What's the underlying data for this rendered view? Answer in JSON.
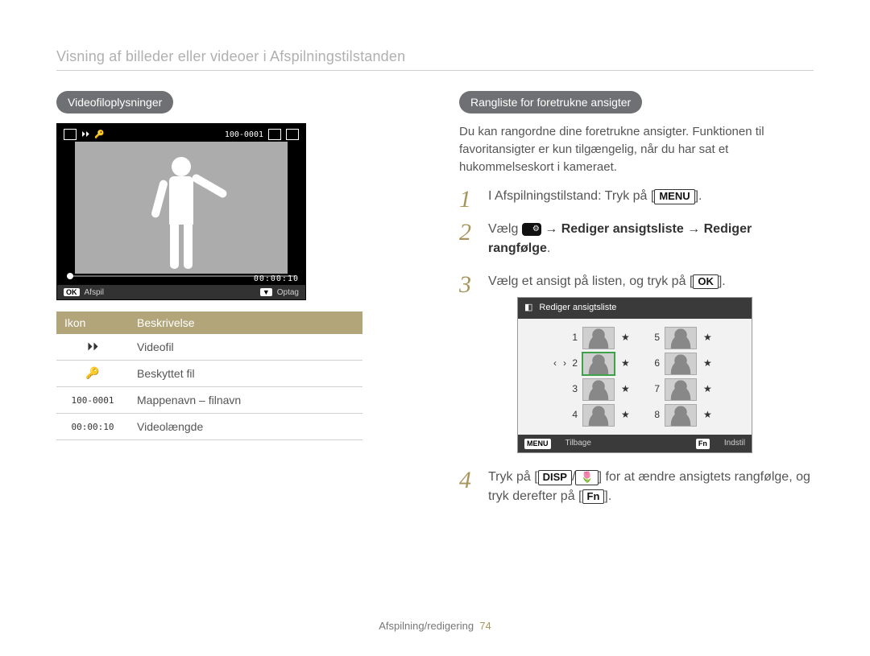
{
  "page": {
    "title": "Visning af billeder eller videoer i Afspilningstilstanden",
    "footer_section": "Afspilning/redigering",
    "footer_page": "74"
  },
  "left": {
    "pill": "Videofiloplysninger",
    "preview": {
      "folder_file": "100-0001",
      "duration": "00:00:10",
      "bottom_ok": "OK",
      "bottom_play": "Afspil",
      "bottom_down": "▼",
      "bottom_record": "Optag"
    },
    "table": {
      "headers": {
        "icon": "Ikon",
        "desc": "Beskrivelse"
      },
      "rows": [
        {
          "icon_name": "video-icon",
          "icon_text": "⏵⏵",
          "desc": "Videofil"
        },
        {
          "icon_name": "lock-icon",
          "icon_text": "🔑",
          "desc": "Beskyttet fil"
        },
        {
          "icon_name": "folder-label",
          "icon_text": "100-0001",
          "desc": "Mappenavn – filnavn"
        },
        {
          "icon_name": "duration-label",
          "icon_text": "00:00:10",
          "desc": "Videolængde"
        }
      ]
    }
  },
  "right": {
    "pill": "Rangliste for foretrukne ansigter",
    "intro": "Du kan rangordne dine foretrukne ansigter. Funktionen til favoritansigter er kun tilgængelig, når du har sat et hukommelseskort i kameraet.",
    "steps": {
      "s1_a": "I Afspilningstilstand: Tryk på [",
      "s1_btn": "MENU",
      "s1_b": "].",
      "s2_a": "Vælg ",
      "s2_b": " → ",
      "s2_bold1": "Rediger ansigtsliste",
      "s2_c": " → ",
      "s2_bold2": "Rediger rangfølge",
      "s2_d": ".",
      "s3_a": "Vælg et ansigt på listen, og tryk på [",
      "s3_btn": "OK",
      "s3_b": "].",
      "s4_a": "Tryk på [",
      "s4_btn1": "DISP",
      "s4_mid": "/",
      "s4_btn2": "🌷",
      "s4_b": "] for at ændre ansigtets rangfølge, og tryk derefter på [",
      "s4_btn3": "Fn",
      "s4_c": "]."
    },
    "face_panel": {
      "title": "Rediger ansigtsliste",
      "menu_label": "MENU",
      "back": "Tilbage",
      "fn_label": "Fn",
      "set": "Indstil",
      "left_nums": [
        "1",
        "2",
        "3",
        "4"
      ],
      "right_nums": [
        "5",
        "6",
        "7",
        "8"
      ]
    }
  }
}
